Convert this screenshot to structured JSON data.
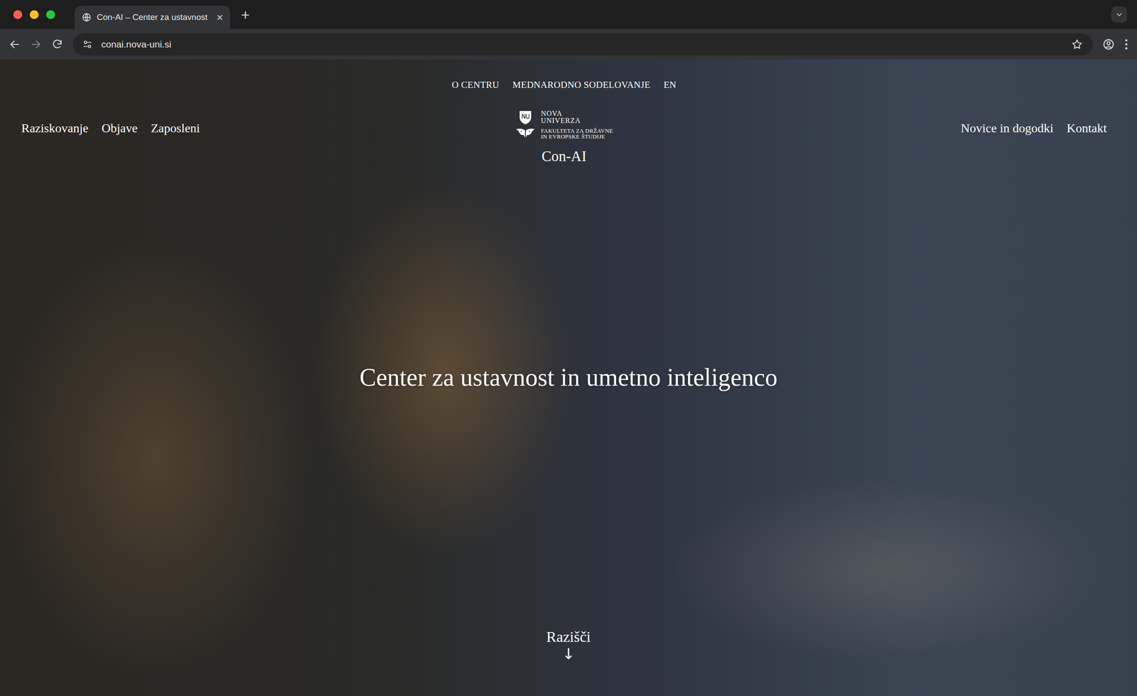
{
  "window": {
    "controls": [
      {
        "name": "close",
        "color": "#ff5f57"
      },
      {
        "name": "minimize",
        "color": "#febc2e"
      },
      {
        "name": "maximize",
        "color": "#28c840"
      }
    ]
  },
  "tabs": [
    {
      "label": "Con-AI – Center za ustavnost",
      "selected": true,
      "close": "×"
    }
  ],
  "new_tab": "+",
  "address": "conai.nova-uni.si",
  "page": {
    "utility_nav": [
      "O CENTRU",
      "MEDNARODNO SODELOVANJE",
      "EN"
    ],
    "nav_left": [
      "Raziskovanje",
      "Objave",
      "Zaposleni"
    ],
    "nav_right": [
      "Novice in dogodki",
      "Kontakt"
    ],
    "logo": {
      "name_lines": [
        "NOVA",
        "UNIVERZA"
      ],
      "faculty_lines": [
        "FAKULTETA ZA DRŽAVNE",
        "IN EVROPSKE ŠTUDIJE"
      ]
    },
    "site": "Con-AI",
    "title": "Center za ustavnost in umetno inteligenco",
    "explore": {
      "label": "Razišči",
      "arrow": "↓"
    }
  }
}
